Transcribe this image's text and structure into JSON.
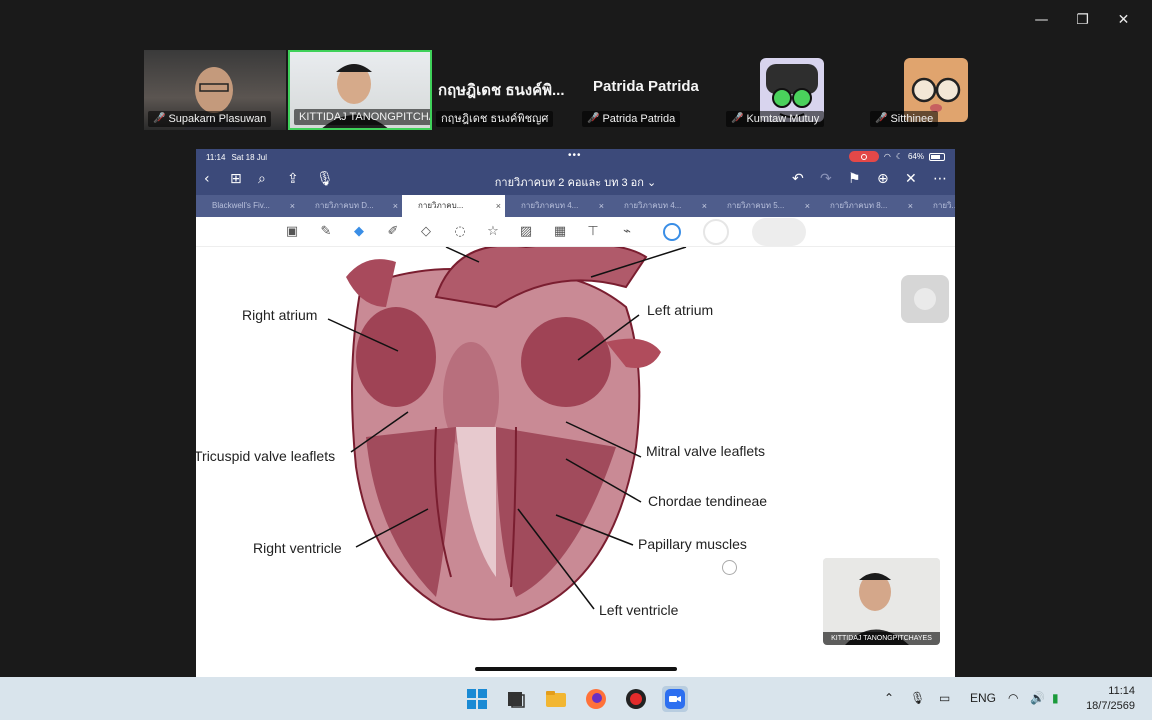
{
  "window_controls": {
    "minimize": "—",
    "restore": "❐",
    "close": "✕"
  },
  "participants": [
    {
      "name": "Supakarn Plasuwan"
    },
    {
      "name": "KITTIDAJ TANONGPITCHA..."
    },
    {
      "display": "กฤษฎิเดช ธนงค์พิ...",
      "name": "กฤษฎิเดช ธนงค์พิชญศ"
    },
    {
      "display": "Patrida Patrida",
      "name": "Patrida Patrida"
    },
    {
      "name": "Kumtaw Mutuy"
    },
    {
      "name": "Sitthinee"
    }
  ],
  "ipad": {
    "status": {
      "time": "11:14",
      "date": "Sat 18 Jul",
      "dots": "•••",
      "battery": "64%"
    },
    "nav": {
      "title": "กายวิภาคบท 2 คอและ บท 3 อก ⌄"
    },
    "tabs": [
      {
        "label": "Blackwell's Fiv..."
      },
      {
        "label": "กายวิภาคบท D..."
      },
      {
        "label": "กายวิภาคบ..."
      },
      {
        "label": "กายวิภาคบท 4..."
      },
      {
        "label": "กายวิภาคบท 4..."
      },
      {
        "label": "กายวิภาคบท 5..."
      },
      {
        "label": "กายวิภาคบท 8..."
      },
      {
        "label": "กายวิ..."
      }
    ],
    "diagram_labels": {
      "right_atrium": "Right atrium",
      "left_atrium": "Left atrium",
      "tricuspid": "Tricuspid valve leaflets",
      "mitral": "Mitral valve leaflets",
      "chordae": "Chordae tendineae",
      "right_ventricle": "Right ventricle",
      "papillary": "Papillary muscles",
      "left_ventricle": "Left ventricle"
    },
    "colors": {
      "nav_bg": "#3c4a7a",
      "accent_blue": "#3a8ee6"
    }
  },
  "self_view": {
    "name": "KITTIDAJ TANONGPITCHAYES"
  },
  "taskbar": {
    "language": "ENG",
    "time": "11:14",
    "date": "18/7/2569"
  }
}
